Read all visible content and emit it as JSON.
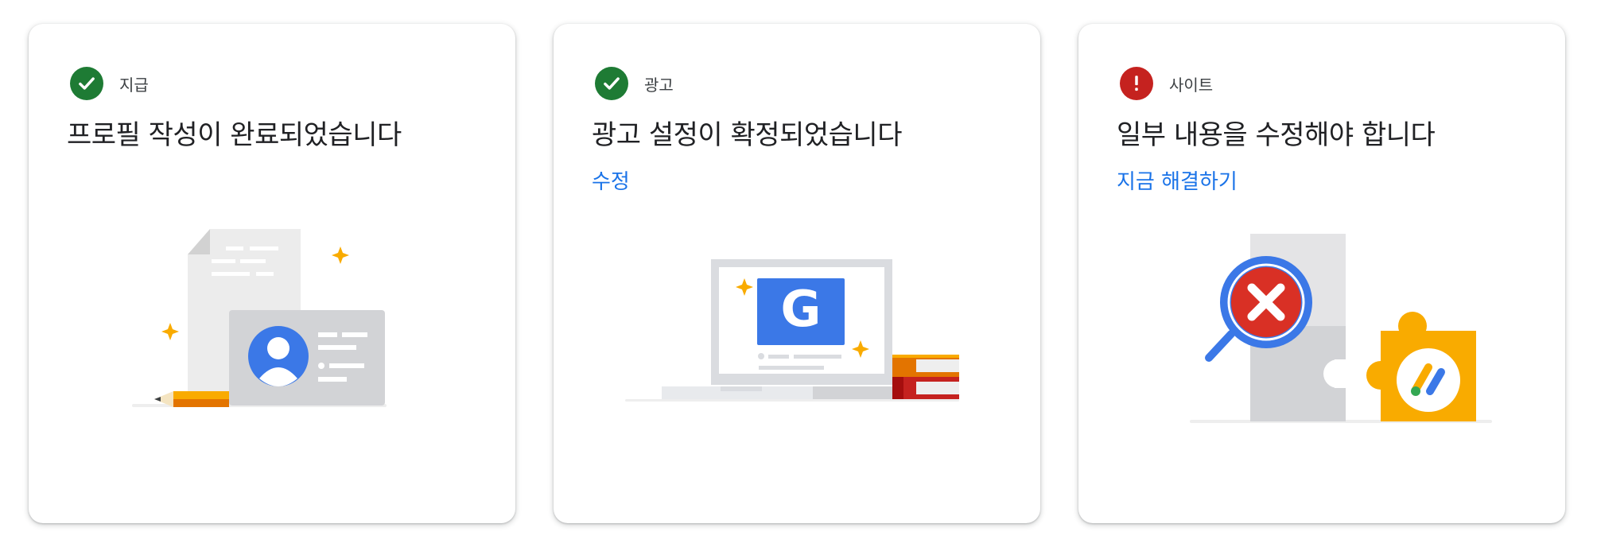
{
  "cards": [
    {
      "status": "success",
      "status_label": "지급",
      "title": "프로필 작성이 완료되었습니다",
      "link": "",
      "illustration": "profile-document-icon"
    },
    {
      "status": "success",
      "status_label": "광고",
      "title": "광고 설정이 확정되었습니다",
      "link": "수정",
      "illustration": "laptop-google-icon"
    },
    {
      "status": "error",
      "status_label": "사이트",
      "title": "일부 내용을 수정해야 합니다",
      "link": "지금 해결하기",
      "illustration": "puzzle-search-error-icon"
    }
  ],
  "colors": {
    "success": "#1e7b34",
    "error": "#c5221f",
    "link": "#1a73e8",
    "google_blue": "#3b78e7",
    "accent_yellow": "#f9ab00"
  },
  "logo_text": "G"
}
